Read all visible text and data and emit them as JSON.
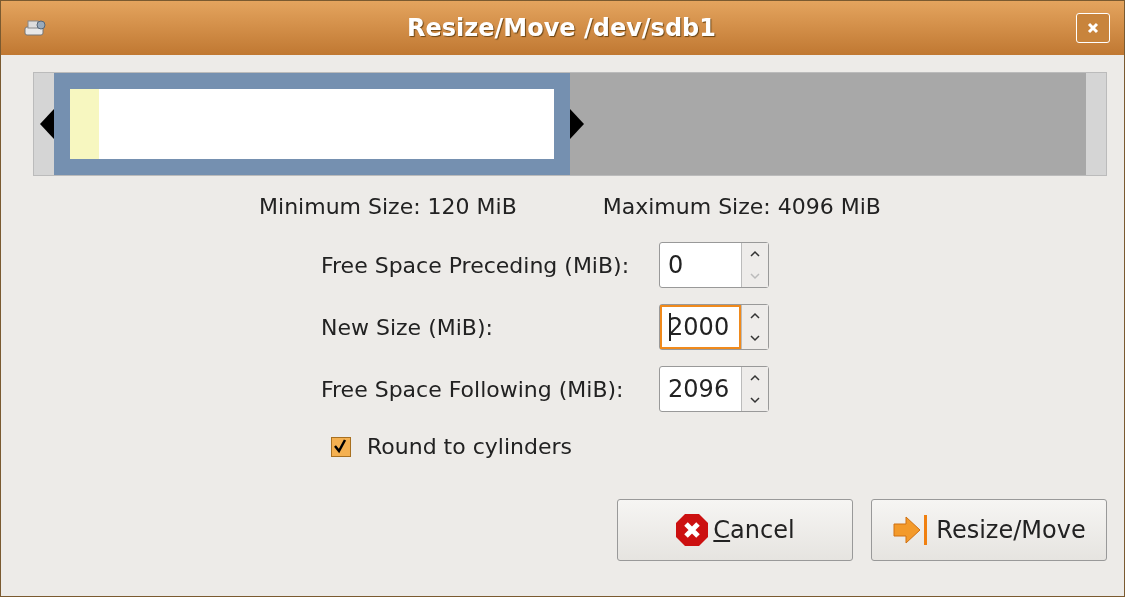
{
  "window": {
    "title": "Resize/Move /dev/sdb1"
  },
  "partition_bar": {
    "used": {
      "level": 0.06
    }
  },
  "limits": {
    "minimum": "Minimum Size: 120 MiB",
    "maximum": "Maximum Size: 4096 MiB"
  },
  "fields": [
    {
      "label": "Free Space Preceding (MiB):",
      "value": "0",
      "focused": false,
      "down_disabled": true
    },
    {
      "label": "New Size (MiB):",
      "value": "2000",
      "focused": true,
      "down_disabled": false
    },
    {
      "label": "Free Space Following (MiB):",
      "value": "2096",
      "focused": false,
      "down_disabled": false
    }
  ],
  "round_to_cylinders": {
    "label": "Round to cylinders",
    "checked": true
  },
  "buttons": [
    {
      "kind": "cancel",
      "label": "Cancel",
      "underline_first": true
    },
    {
      "kind": "apply",
      "label": "Resize/Move",
      "underline_first": false
    }
  ]
}
